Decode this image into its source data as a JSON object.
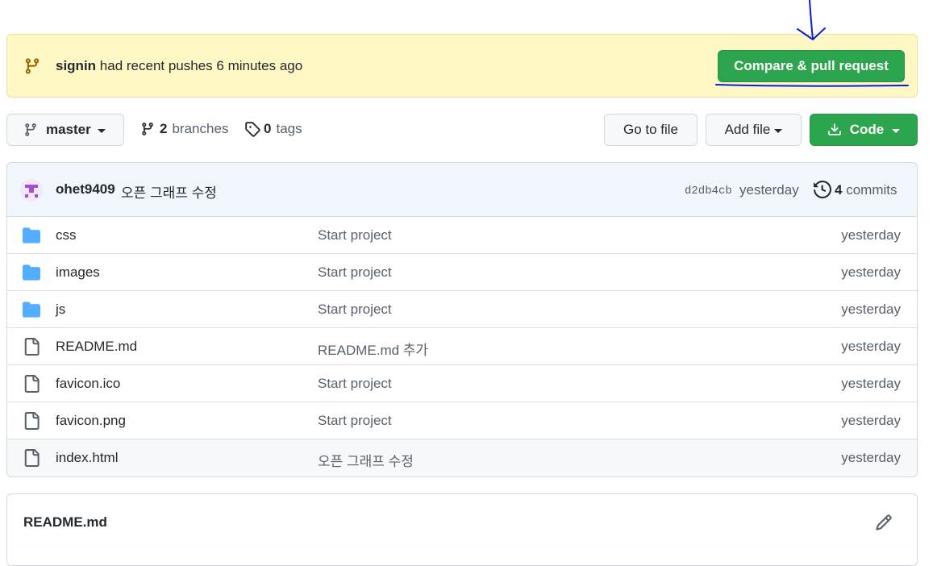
{
  "banner": {
    "user": "signin",
    "text": "had recent pushes 6 minutes ago",
    "compare_button": "Compare & pull request"
  },
  "toolbar": {
    "branch": "master",
    "branches_count": "2",
    "branches_label": "branches",
    "tags_count": "0",
    "tags_label": "tags",
    "go_to_file": "Go to file",
    "add_file": "Add file",
    "code": "Code"
  },
  "commit": {
    "author": "ohet9409",
    "message": "오픈 그래프 수정",
    "sha": "d2db4cb",
    "time": "yesterday",
    "commits_count": "4",
    "commits_label": "commits"
  },
  "files": [
    {
      "name": "css",
      "type": "folder",
      "message": "Start project",
      "time": "yesterday"
    },
    {
      "name": "images",
      "type": "folder",
      "message": "Start project",
      "time": "yesterday"
    },
    {
      "name": "js",
      "type": "folder",
      "message": "Start project",
      "time": "yesterday"
    },
    {
      "name": "README.md",
      "type": "file",
      "message": "README.md 추가",
      "time": "yesterday"
    },
    {
      "name": "favicon.ico",
      "type": "file",
      "message": "Start project",
      "time": "yesterday"
    },
    {
      "name": "favicon.png",
      "type": "file",
      "message": "Start project",
      "time": "yesterday"
    },
    {
      "name": "index.html",
      "type": "file",
      "message": "오픈 그래프 수정",
      "time": "yesterday"
    }
  ],
  "readme": {
    "title": "README.md"
  },
  "colors": {
    "green": "#2da44e",
    "banner_bg": "#fff8c5",
    "folder": "#54aeff",
    "annotation": "#0a1fd6"
  },
  "icons": {
    "banner": "git-branch-icon",
    "history": "history-icon",
    "edit": "pencil-icon",
    "folder": "folder-icon",
    "file": "file-icon",
    "download": "download-icon",
    "tag": "tag-icon"
  }
}
